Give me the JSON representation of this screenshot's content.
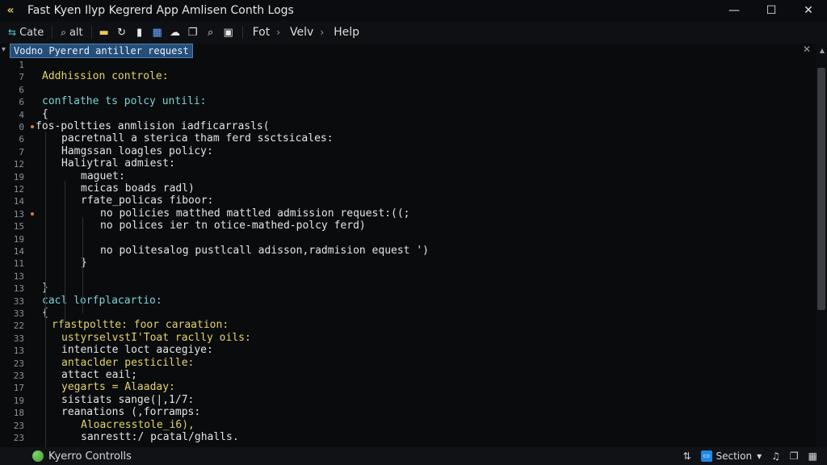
{
  "window": {
    "title": "Fast Kyen Ilyp Kegrerd App Amlisen Conth Logs",
    "controls": {
      "minimize": "—",
      "maximize": "☐",
      "close": "✕"
    }
  },
  "toolbar": {
    "items": [
      {
        "glyph": "⇆",
        "label": "Cate"
      },
      {
        "glyph": "⌕",
        "label": "alt"
      }
    ],
    "icons": [
      "folder-icon",
      "refresh-icon",
      "library-icon",
      "grid-icon",
      "cloud-icon",
      "copy-icon",
      "search-icon",
      "shield-icon"
    ],
    "menu": [
      "Fot",
      "Velv",
      "Help"
    ]
  },
  "editor": {
    "header_chip": "Vodno Pyererd antiller request",
    "lines": [
      {
        "num": "1",
        "text": ""
      },
      {
        "num": "7",
        "text": "Addhission controle:",
        "color": "yellow",
        "indent": 0
      },
      {
        "num": "6",
        "text": "",
        "indent": 0
      },
      {
        "num": "6",
        "text": "conflathe ts polcy untili:",
        "color": "teal",
        "indent": 0
      },
      {
        "num": "4",
        "text": "{",
        "color": "white",
        "indent": 0
      },
      {
        "num": "0",
        "text": "fos-poltties anmlision iadficarrasls(",
        "color": "white",
        "indent": -1,
        "marker": true
      },
      {
        "num": "6",
        "text": "pacretnall a sterica tham ferd ssctsicales:",
        "color": "white",
        "indent": 2
      },
      {
        "num": "7",
        "text": "Hamgssan loagles policy:",
        "color": "white",
        "indent": 2
      },
      {
        "num": "12",
        "text": "Haliytral admiest:",
        "color": "white",
        "indent": 2
      },
      {
        "num": "19",
        "text": "maguet:",
        "color": "white",
        "indent": 4
      },
      {
        "num": "12",
        "text": "mcicas boads radl)",
        "color": "white",
        "indent": 4
      },
      {
        "num": "14",
        "text": "rfate_policas fiboor:",
        "color": "white",
        "indent": 4
      },
      {
        "num": "13",
        "text": "no policies matthed mattled admission request:((;",
        "color": "white",
        "indent": 6,
        "marker": true
      },
      {
        "num": "15",
        "text": "no polices ier tn otice-mathed-polcy ferd)",
        "color": "white",
        "indent": 6
      },
      {
        "num": "19",
        "text": "",
        "indent": 0
      },
      {
        "num": "14",
        "text": "no politesalog pustlcall adisson,radmision equest ')",
        "color": "white",
        "indent": 6
      },
      {
        "num": "11",
        "text": "}",
        "color": "white",
        "indent": 4
      },
      {
        "num": "13",
        "text": "",
        "indent": 0
      },
      {
        "num": "13",
        "text": "}",
        "color": "white",
        "indent": 0
      },
      {
        "num": "33",
        "text": "cacl lorfplacartio:",
        "color": "teal",
        "indent": 0
      },
      {
        "num": "33",
        "text": "{",
        "color": "white",
        "indent": 0
      },
      {
        "num": "22",
        "text": "rfastpoltte: foor caraation:",
        "color": "yellow",
        "indent": 1
      },
      {
        "num": "33",
        "text": "ustyrselvstI'Toat raclly oils:",
        "color": "yellow",
        "indent": 2
      },
      {
        "num": "13",
        "text": "intenicte loct aacegiye:",
        "color": "white",
        "indent": 2
      },
      {
        "num": "23",
        "text": "antaclder pesticille:",
        "color": "yellow",
        "indent": 2
      },
      {
        "num": "23",
        "text": "attact eail;",
        "color": "white",
        "indent": 2
      },
      {
        "num": "17",
        "text": "yegarts = Alaaday:",
        "color": "yellow",
        "indent": 2
      },
      {
        "num": "19",
        "text": "sistiats sange(|,1/7:",
        "color": "white",
        "indent": 2
      },
      {
        "num": "18",
        "text": "reanations (,forramps:",
        "color": "white",
        "indent": 2
      },
      {
        "num": "23",
        "text": "Aloacresstole_i6),",
        "color": "yellow",
        "indent": 4
      },
      {
        "num": "23",
        "text": "sanrestt:/ pcatal/ghalls.",
        "color": "white",
        "indent": 4
      }
    ]
  },
  "status": {
    "left_label": "Kyerro Controlls",
    "right": {
      "arrows": "⇅",
      "section": "Section",
      "section_chevron": "▾",
      "bell": "🔔",
      "copy": "❐",
      "layout": "▦"
    }
  }
}
